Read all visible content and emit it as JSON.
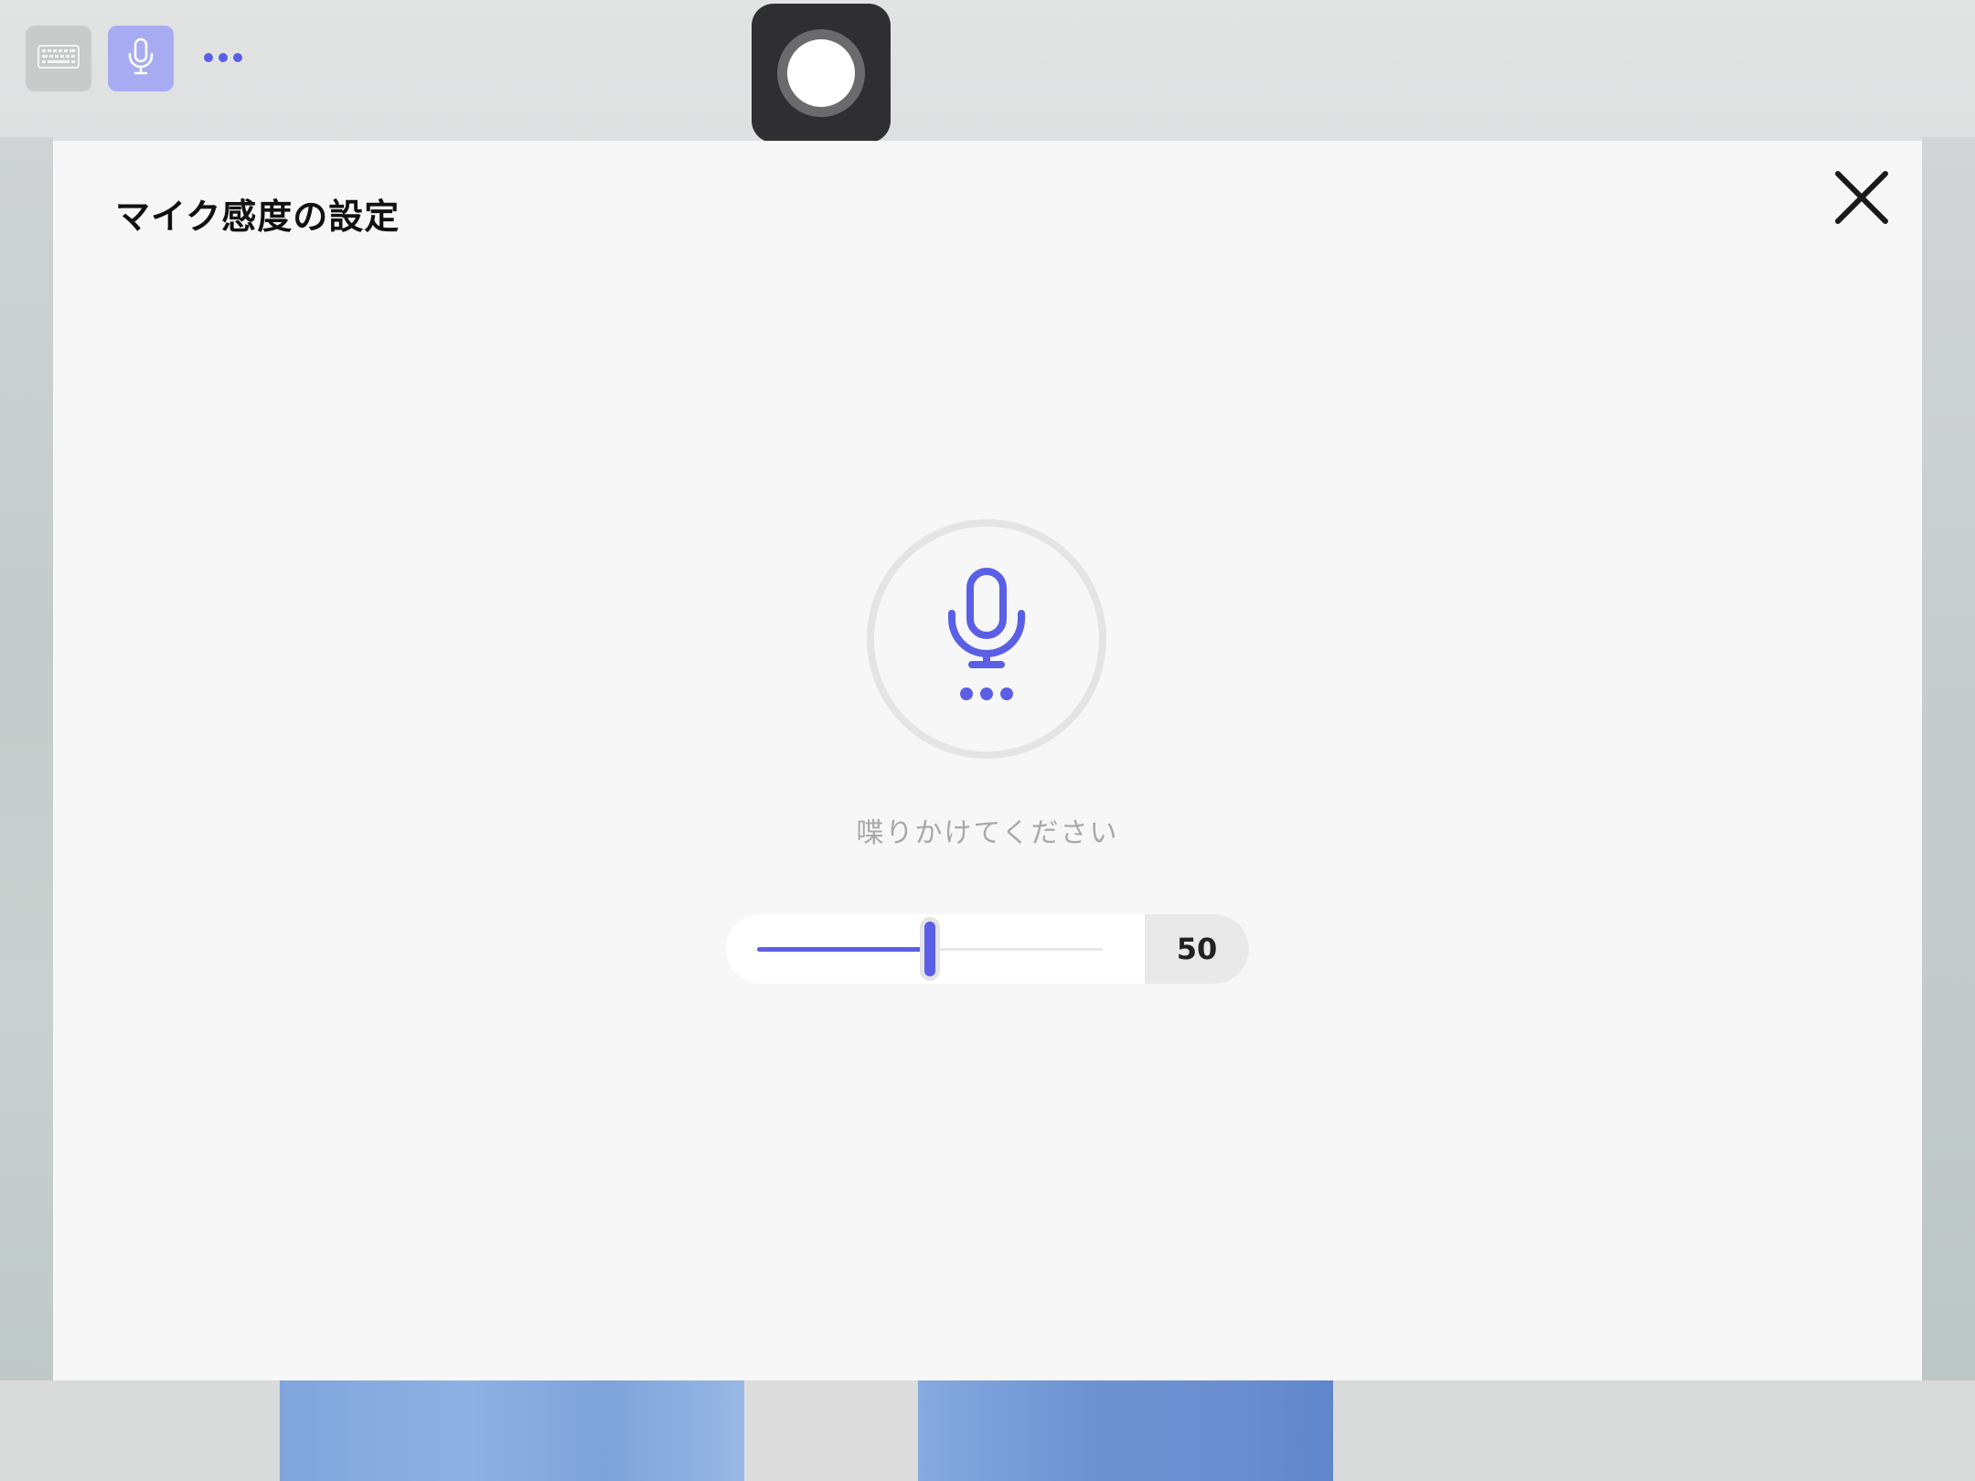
{
  "toolbar": {
    "keyboard_icon": "keyboard-icon",
    "mic_icon": "microphone-icon",
    "more_icon": "ellipsis-icon"
  },
  "record": {
    "icon": "record-icon"
  },
  "dialog": {
    "title": "マイク感度の設定",
    "close_icon": "close-icon",
    "prompt": "喋りかけてください",
    "mic_icon": "microphone-icon",
    "listening_icon": "ellipsis-icon"
  },
  "sensitivity": {
    "value": "50",
    "fraction": 0.5
  },
  "colors": {
    "accent": "#5b5fe6",
    "accent_light": "#a7acf2",
    "dialog_bg": "#f7f7f7",
    "title_text": "#111111",
    "prompt_text": "#a8a8a8"
  }
}
